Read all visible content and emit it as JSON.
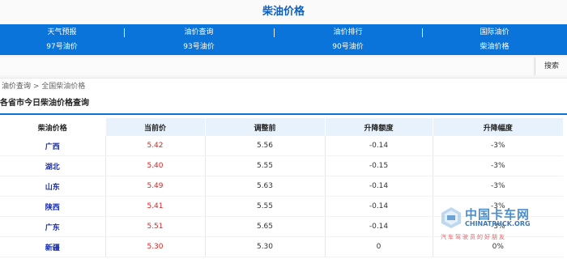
{
  "page_title": "柴油价格",
  "nav": {
    "row1": [
      "天气预报",
      "油价查询",
      "油价排行",
      "国际油价"
    ],
    "row2": [
      "97号油价",
      "93号油价",
      "90号油价",
      "柴油价格"
    ]
  },
  "search": {
    "value": "",
    "button_label": "搜索"
  },
  "breadcrumb": {
    "link": "油价查询",
    "separator": " > ",
    "current": "全国柴油价格"
  },
  "section_title": "各省市今日柴油价格查询",
  "table": {
    "headers": [
      "柴油价格",
      "当前价",
      "调整前",
      "升降额度",
      "升降幅度"
    ],
    "rows": [
      [
        "广西",
        "5.42",
        "5.56",
        "-0.14",
        "-3%"
      ],
      [
        "湖北",
        "5.40",
        "5.55",
        "-0.15",
        "-3%"
      ],
      [
        "山东",
        "5.49",
        "5.63",
        "-0.14",
        "-3%"
      ],
      [
        "陕西",
        "5.41",
        "5.55",
        "-0.14",
        "-3%"
      ],
      [
        "广东",
        "5.51",
        "5.65",
        "-0.14",
        "-3%"
      ],
      [
        "新疆",
        "5.30",
        "5.30",
        "0",
        "0%"
      ]
    ]
  },
  "watermark": {
    "text": "中国卡车网",
    "en": "CHINATRUCK.ORG",
    "sub": "汽车驾驶员的好朋友"
  },
  "colors": {
    "nav_bg": "#0a74db",
    "title": "#0f5fbf",
    "current_price": "#e02020",
    "province": "#1a2fb0"
  }
}
